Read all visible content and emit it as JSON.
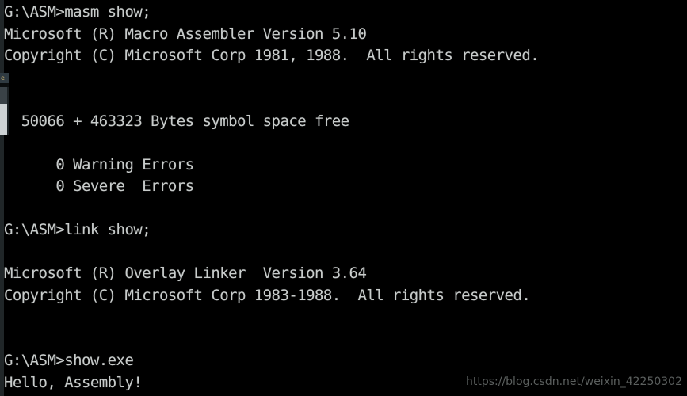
{
  "window": {
    "title": "G:\\ASM",
    "background_color": "#000000",
    "text_color": "#c8cccb",
    "left_edge_color": "#202628"
  },
  "edge_artifact": {
    "tab_label": "e",
    "tab_color": "#2f3a41",
    "scrollbar_track_color": "#3a4247",
    "scrollbar_thumb_color": "#cdd2d4"
  },
  "console": {
    "prompt": "G:\\ASM>",
    "lines": [
      "G:\\ASM>masm show;",
      "Microsoft (R) Macro Assembler Version 5.10",
      "Copyright (C) Microsoft Corp 1981, 1988.  All rights reserved.",
      "",
      "",
      "  50066 + 463323 Bytes symbol space free",
      "",
      "      0 Warning Errors",
      "      0 Severe  Errors",
      "",
      "G:\\ASM>link show;",
      "",
      "Microsoft (R) Overlay Linker  Version 3.64",
      "Copyright (C) Microsoft Corp 1983-1988.  All rights reserved.",
      "",
      "",
      "G:\\ASM>show.exe",
      "Hello, Assembly!"
    ],
    "commands": [
      "masm show;",
      "link show;",
      "show.exe"
    ],
    "assembler": {
      "product": "Microsoft (R) Macro Assembler",
      "version": "5.10",
      "copyright": "Copyright (C) Microsoft Corp 1981, 1988.  All rights reserved.",
      "symbol_space_used": "50066",
      "symbol_space_free": "463323",
      "symbol_space_line": "  50066 + 463323 Bytes symbol space free",
      "warning_errors": "0",
      "severe_errors": "0",
      "warning_errors_line": "      0 Warning Errors",
      "severe_errors_line": "      0 Severe  Errors"
    },
    "linker": {
      "product": "Microsoft (R) Overlay Linker",
      "version": "3.64",
      "copyright": "Copyright (C) Microsoft Corp 1983-1988.  All rights reserved."
    },
    "program_output": "Hello, Assembly!"
  },
  "watermark": {
    "text": "https://blog.csdn.net/weixin_42250302",
    "color": "#5b5f5e"
  }
}
